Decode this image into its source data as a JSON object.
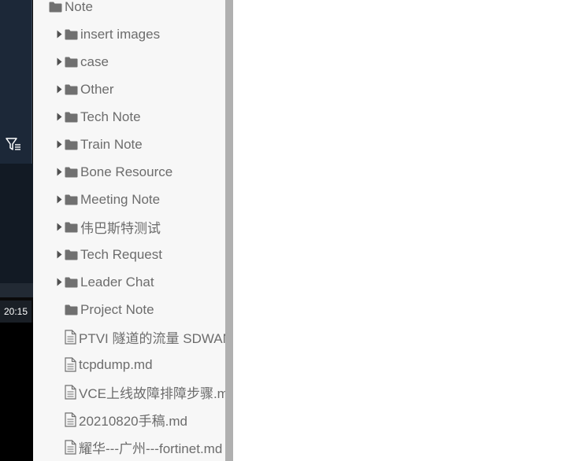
{
  "left_panel": {
    "time": "20:15"
  },
  "tree": {
    "root": {
      "label": "Note"
    },
    "folders": [
      {
        "label": "insert images",
        "expandable": true
      },
      {
        "label": "case",
        "expandable": true
      },
      {
        "label": "Other",
        "expandable": true
      },
      {
        "label": "Tech Note",
        "expandable": true
      },
      {
        "label": "Train Note",
        "expandable": true
      },
      {
        "label": "Bone Resource",
        "expandable": true
      },
      {
        "label": "Meeting Note",
        "expandable": true
      },
      {
        "label": "伟巴斯特测试",
        "expandable": true
      },
      {
        "label": "Tech Request",
        "expandable": true
      },
      {
        "label": "Leader Chat",
        "expandable": true
      },
      {
        "label": "Project Note",
        "expandable": false
      }
    ],
    "files": [
      {
        "label": "PTVI 隧道的流量 SDWAN"
      },
      {
        "label": "tcpdump.md"
      },
      {
        "label": "VCE上线故障排障步骤.md"
      },
      {
        "label": "20210820手稿.md"
      },
      {
        "label": "耀华---广州---fortinet.md"
      }
    ]
  },
  "colors": {
    "panel_bg": "#f7f7f7",
    "text": "#6c6c6c",
    "icon": "#707070",
    "scrollbar": "#b0b0b0",
    "sidebar_dark": "#1c2838"
  }
}
